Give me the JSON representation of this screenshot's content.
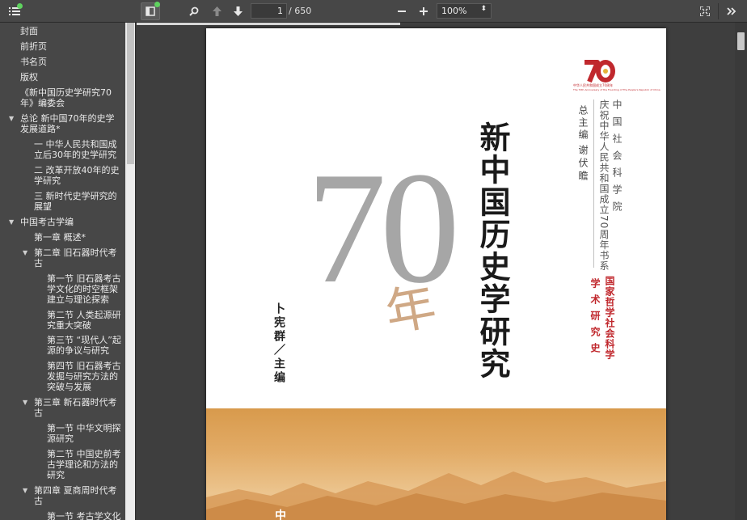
{
  "toolbar": {
    "page_number": "1",
    "page_count": "/ 650",
    "zoom_value": "100%"
  },
  "outline": [
    {
      "label": "封面"
    },
    {
      "label": "前折页"
    },
    {
      "label": "书名页"
    },
    {
      "label": "版权"
    },
    {
      "label": "《新中国历史学研究70年》编委会"
    },
    {
      "label": "总论 新中国70年的史学发展道路*"
    },
    {
      "label": "一 中华人民共和国成立后30年的史学研究"
    },
    {
      "label": "二 改革开放40年的史学研究"
    },
    {
      "label": "三 新时代史学研究的展望"
    },
    {
      "label": "中国考古学编"
    },
    {
      "label": "第一章 概述*"
    },
    {
      "label": "第二章 旧石器时代考古"
    },
    {
      "label": "第一节 旧石器考古学文化的时空框架建立与理论探索"
    },
    {
      "label": "第二节 人类起源研究重大突破"
    },
    {
      "label": "第三节 “现代人”起源的争议与研究"
    },
    {
      "label": "第四节 旧石器考古发掘与研究方法的突破与发展"
    },
    {
      "label": "第三章 新石器时代考古"
    },
    {
      "label": "第一节 中华文明探源研究"
    },
    {
      "label": "第二节 中国史前考古学理论和方法的研究"
    },
    {
      "label": "第四章 夏商周时代考古"
    },
    {
      "label": "第一节 考古学文化"
    }
  ],
  "cover": {
    "big_number": "70",
    "year_char": "年",
    "title": "新中国历史学研究",
    "author": "卜宪群／主编",
    "chief_editor_label": "总主编",
    "chief_editor_name": "谢伏瞻",
    "institution": "中国社会科学院",
    "series": "庆祝中华人民共和国成立70周年书系",
    "nsf_line1": "国家哲学社会科学",
    "nsf_line2": "学术研究史",
    "logo_number": "70",
    "logo_caption_1": "中华人民共和国成立70周年",
    "logo_caption_2": "The 70th Anniversary of the Founding of The People's Republic of China",
    "bottom_mark": "中"
  },
  "colors": {
    "accent_red": "#c0282d",
    "toolbar_bg": "#474747",
    "band_orange": "#e2ab66"
  }
}
